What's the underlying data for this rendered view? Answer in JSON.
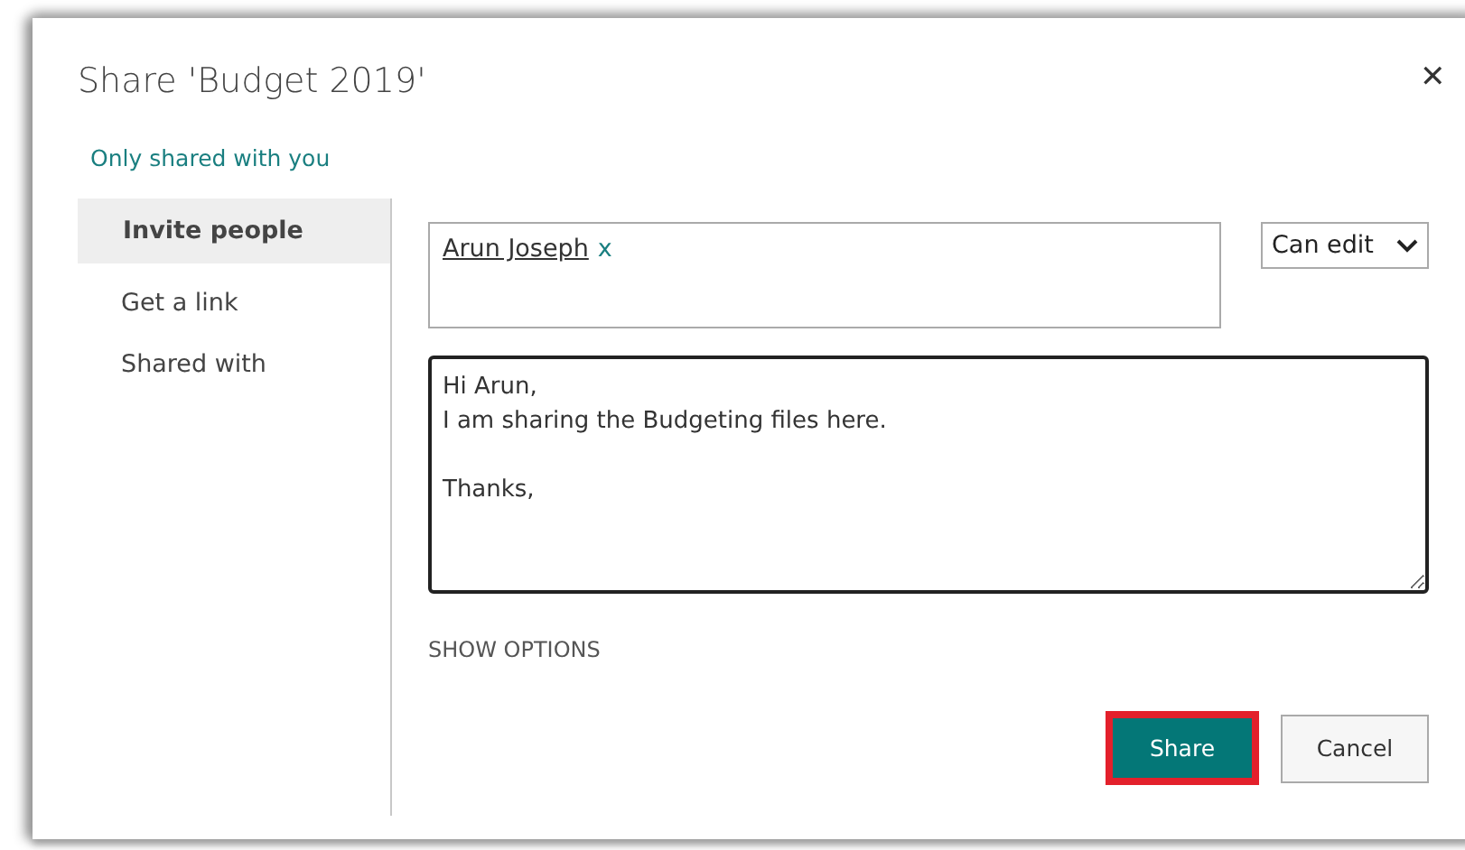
{
  "dialog": {
    "title": "Share 'Budget 2019'",
    "close": "✕",
    "status": "Only shared with you"
  },
  "sidebar": {
    "items": [
      {
        "label": "Invite people",
        "selected": true
      },
      {
        "label": "Get a link",
        "selected": false
      },
      {
        "label": "Shared with",
        "selected": false
      }
    ]
  },
  "invite": {
    "people": [
      {
        "name": "Arun Joseph",
        "remove": "x"
      }
    ],
    "permission": "Can edit",
    "message": "Hi Arun,\nI am sharing the Budgeting files here.\n\nThanks,",
    "show_options": "SHOW OPTIONS"
  },
  "buttons": [
    {
      "label": "Share",
      "kind": "primary",
      "highlighted": true
    },
    {
      "label": "Cancel",
      "kind": "secondary",
      "highlighted": false
    }
  ]
}
